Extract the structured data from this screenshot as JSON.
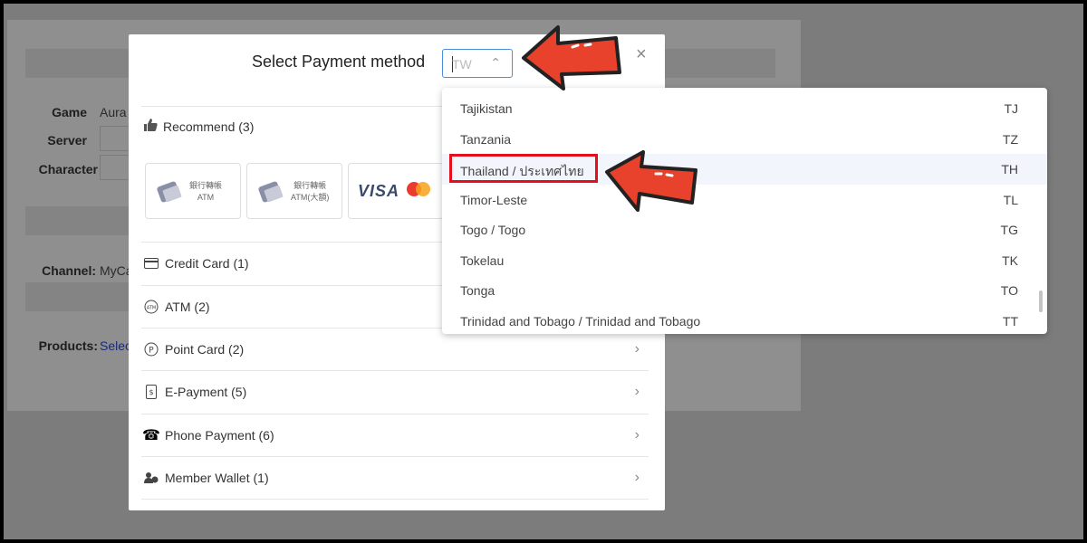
{
  "background": {
    "game_label": "Game",
    "game_value": "Aura I",
    "server_label": "Server",
    "character_label": "Character",
    "channel_label": "Channel:",
    "channel_value": "MyCa",
    "products_label": "Products:",
    "products_link": "Selec"
  },
  "modal": {
    "title": "Select Payment method",
    "region_select": {
      "value": "TW",
      "placeholder": "TW"
    },
    "close_glyph": "×",
    "recommend_label": "Recommend (3)",
    "recommend_cards": [
      {
        "line1": "銀行轉帳",
        "line2": "ATM"
      },
      {
        "line1": "銀行轉帳",
        "line2": "ATM(大額)"
      },
      {
        "brand": "VISA"
      }
    ],
    "methods": [
      {
        "label": "Credit Card (1)",
        "icon": "credit-card-icon"
      },
      {
        "label": "ATM (2)",
        "icon": "atm-icon"
      },
      {
        "label": "Point Card (2)",
        "icon": "point-card-icon"
      },
      {
        "label": "E-Payment (5)",
        "icon": "e-payment-icon"
      },
      {
        "label": "Phone Payment (6)",
        "icon": "phone-icon"
      },
      {
        "label": "Member Wallet (1)",
        "icon": "wallet-icon"
      }
    ]
  },
  "dropdown": {
    "items": [
      {
        "name": "Tajikistan",
        "code": "TJ"
      },
      {
        "name": "Tanzania",
        "code": "TZ"
      },
      {
        "name": "Thailand / ประเทศไทย",
        "code": "TH"
      },
      {
        "name": "Timor-Leste",
        "code": "TL"
      },
      {
        "name": "Togo / Togo",
        "code": "TG"
      },
      {
        "name": "Tokelau",
        "code": "TK"
      },
      {
        "name": "Tonga",
        "code": "TO"
      },
      {
        "name": "Trinidad and Tobago / Trinidad and Tobago",
        "code": "TT"
      }
    ],
    "highlighted": "Thailand / ประเทศไทย"
  },
  "colors": {
    "annotation_red": "#e8412c",
    "highlight_red": "#e3101b",
    "select_border": "#4a90d9"
  }
}
